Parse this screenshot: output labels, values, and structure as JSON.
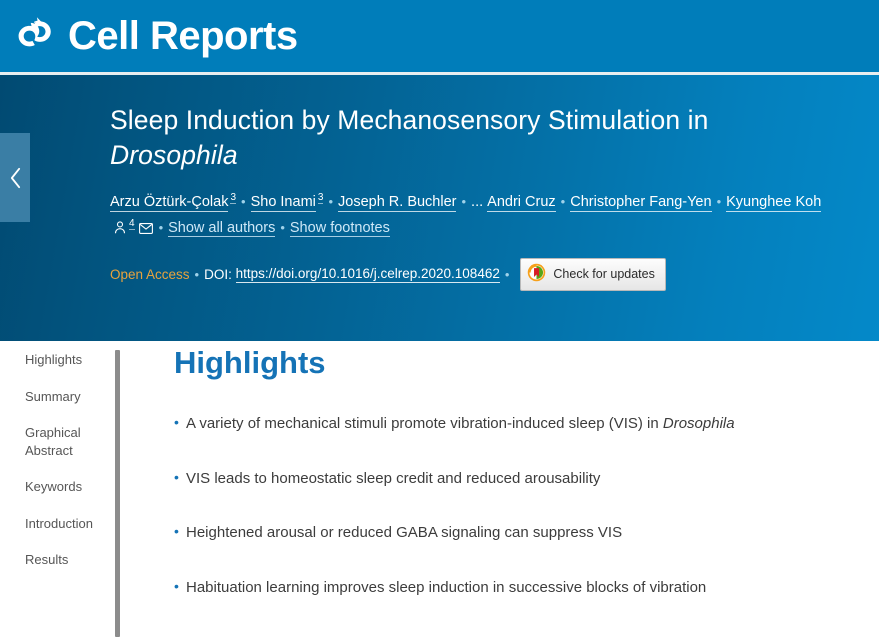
{
  "masthead": {
    "journal": "Cell Reports",
    "logo_icon": "cell-press-logo-icon"
  },
  "hero": {
    "collapse_icon": "chevron-left-icon",
    "title_line1": "Sleep Induction by Mechanosensory Stimulation in",
    "title_line2": "Drosophila",
    "authors": [
      {
        "name": "Arzu Öztürk-Çolak",
        "sup": "3"
      },
      {
        "name": "Sho Inami",
        "sup": "3"
      },
      {
        "name": "Joseph R. Buchler",
        "sup": ""
      },
      {
        "name": "Andri Cruz",
        "sup": ""
      },
      {
        "name": "Christopher Fang-Yen",
        "sup": ""
      },
      {
        "name": "Kyunghee Koh",
        "sup": "4"
      }
    ],
    "ellipsis": "...",
    "corresponding_icon": "person-icon",
    "email_icon": "envelope-icon",
    "show_all_authors": "Show all authors",
    "show_footnotes": "Show footnotes",
    "open_access": "Open Access",
    "doi_label": "DOI:",
    "doi_url": "https://doi.org/10.1016/j.celrep.2020.108462",
    "crossmark": {
      "icon": "crossmark-icon",
      "label": "Check for updates"
    },
    "separator": "•"
  },
  "sidebar": {
    "items": [
      {
        "label": "Highlights"
      },
      {
        "label": "Summary"
      },
      {
        "label": "Graphical Abstract"
      },
      {
        "label": "Keywords"
      },
      {
        "label": "Introduction"
      },
      {
        "label": "Results"
      }
    ]
  },
  "main": {
    "heading": "Highlights",
    "highlights": [
      {
        "text": "A variety of mechanical stimuli promote vibration-induced sleep (VIS) in ",
        "italic": "Drosophila",
        "tail": ""
      },
      {
        "text": "VIS leads to homeostatic sleep credit and reduced arousability",
        "italic": "",
        "tail": ""
      },
      {
        "text": "Heightened arousal or reduced GABA signaling can suppress VIS",
        "italic": "",
        "tail": ""
      },
      {
        "text": "Habituation learning improves sleep induction in successive blocks of vibration",
        "italic": "",
        "tail": ""
      }
    ]
  },
  "colors": {
    "brand_blue": "#007dba",
    "hero_dark": "#014a72",
    "hero_light": "#0489c9",
    "open_access_orange": "#e8a33d",
    "heading_blue": "#1573b6",
    "collapse_tab": "#3a7ea5"
  }
}
